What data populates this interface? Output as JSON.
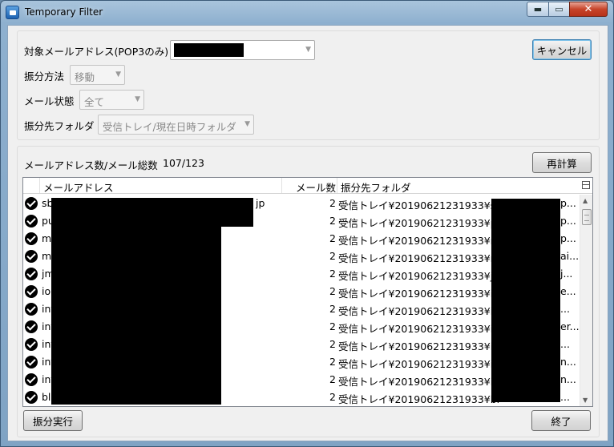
{
  "window": {
    "title": "Temporary Filter",
    "min_glyph": "▬",
    "max_glyph": "▭",
    "close_glyph": "✕"
  },
  "form": {
    "target_label": "対象メールアドレス(POP3のみ)",
    "method_label": "振分方法",
    "method_value": "移動",
    "state_label": "メール状態",
    "state_value": "全て",
    "folder_label": "振分先フォルダ",
    "folder_value": "受信トレイ/現在日時フォルダ",
    "cancel_label": "キャンセル"
  },
  "summary": {
    "label": "メールアドレス数/メール総数",
    "value": "107/123",
    "recalc_label": "再計算"
  },
  "table": {
    "columns": [
      "メールアドレス",
      "メール数",
      "振分先フォルダ"
    ],
    "rows": [
      {
        "email": "sb",
        "email_tail": "jp",
        "count": "2",
        "folder": "受信トレイ¥20190621231933¥sb",
        "folder_tail": "p..."
      },
      {
        "email": "pu",
        "email_tail": "",
        "count": "2",
        "folder": "受信トレイ¥20190621231933¥pu",
        "folder_tail": "p..."
      },
      {
        "email": "m",
        "email_tail": "",
        "count": "2",
        "folder": "受信トレイ¥20190621231933¥m",
        "folder_tail": "p..."
      },
      {
        "email": "m",
        "email_tail": "",
        "count": "2",
        "folder": "受信トレイ¥20190621231933¥m",
        "folder_tail": "ai..."
      },
      {
        "email": "jm",
        "email_tail": "",
        "count": "2",
        "folder": "受信トレイ¥20190621231933¥jm",
        "folder_tail": "j..."
      },
      {
        "email": "io",
        "email_tail": "",
        "count": "2",
        "folder": "受信トレイ¥20190621231933¥io",
        "folder_tail": "e..."
      },
      {
        "email": "int",
        "email_tail": "",
        "count": "2",
        "folder": "受信トレイ¥20190621231933¥int",
        "folder_tail": "..."
      },
      {
        "email": "int",
        "email_tail": "",
        "count": "2",
        "folder": "受信トレイ¥20190621231933¥int",
        "folder_tail": "er..."
      },
      {
        "email": "int",
        "email_tail": "",
        "count": "2",
        "folder": "受信トレイ¥20190621231933¥int",
        "folder_tail": "..."
      },
      {
        "email": "int",
        "email_tail": "",
        "count": "2",
        "folder": "受信トレイ¥20190621231933¥int",
        "folder_tail": "n..."
      },
      {
        "email": "int",
        "email_tail": "",
        "count": "2",
        "folder": "受信トレイ¥20190621231933¥int",
        "folder_tail": "n..."
      },
      {
        "email": "bl",
        "email_tail": "",
        "count": "2",
        "folder": "受信トレイ¥20190621231933¥bl",
        "folder_tail": "..."
      }
    ]
  },
  "footer": {
    "execute_label": "振分実行",
    "finish_label": "終了"
  },
  "icons": {
    "check": "check-circle-icon",
    "scroll_up": "▲",
    "scroll_down": "▼"
  }
}
